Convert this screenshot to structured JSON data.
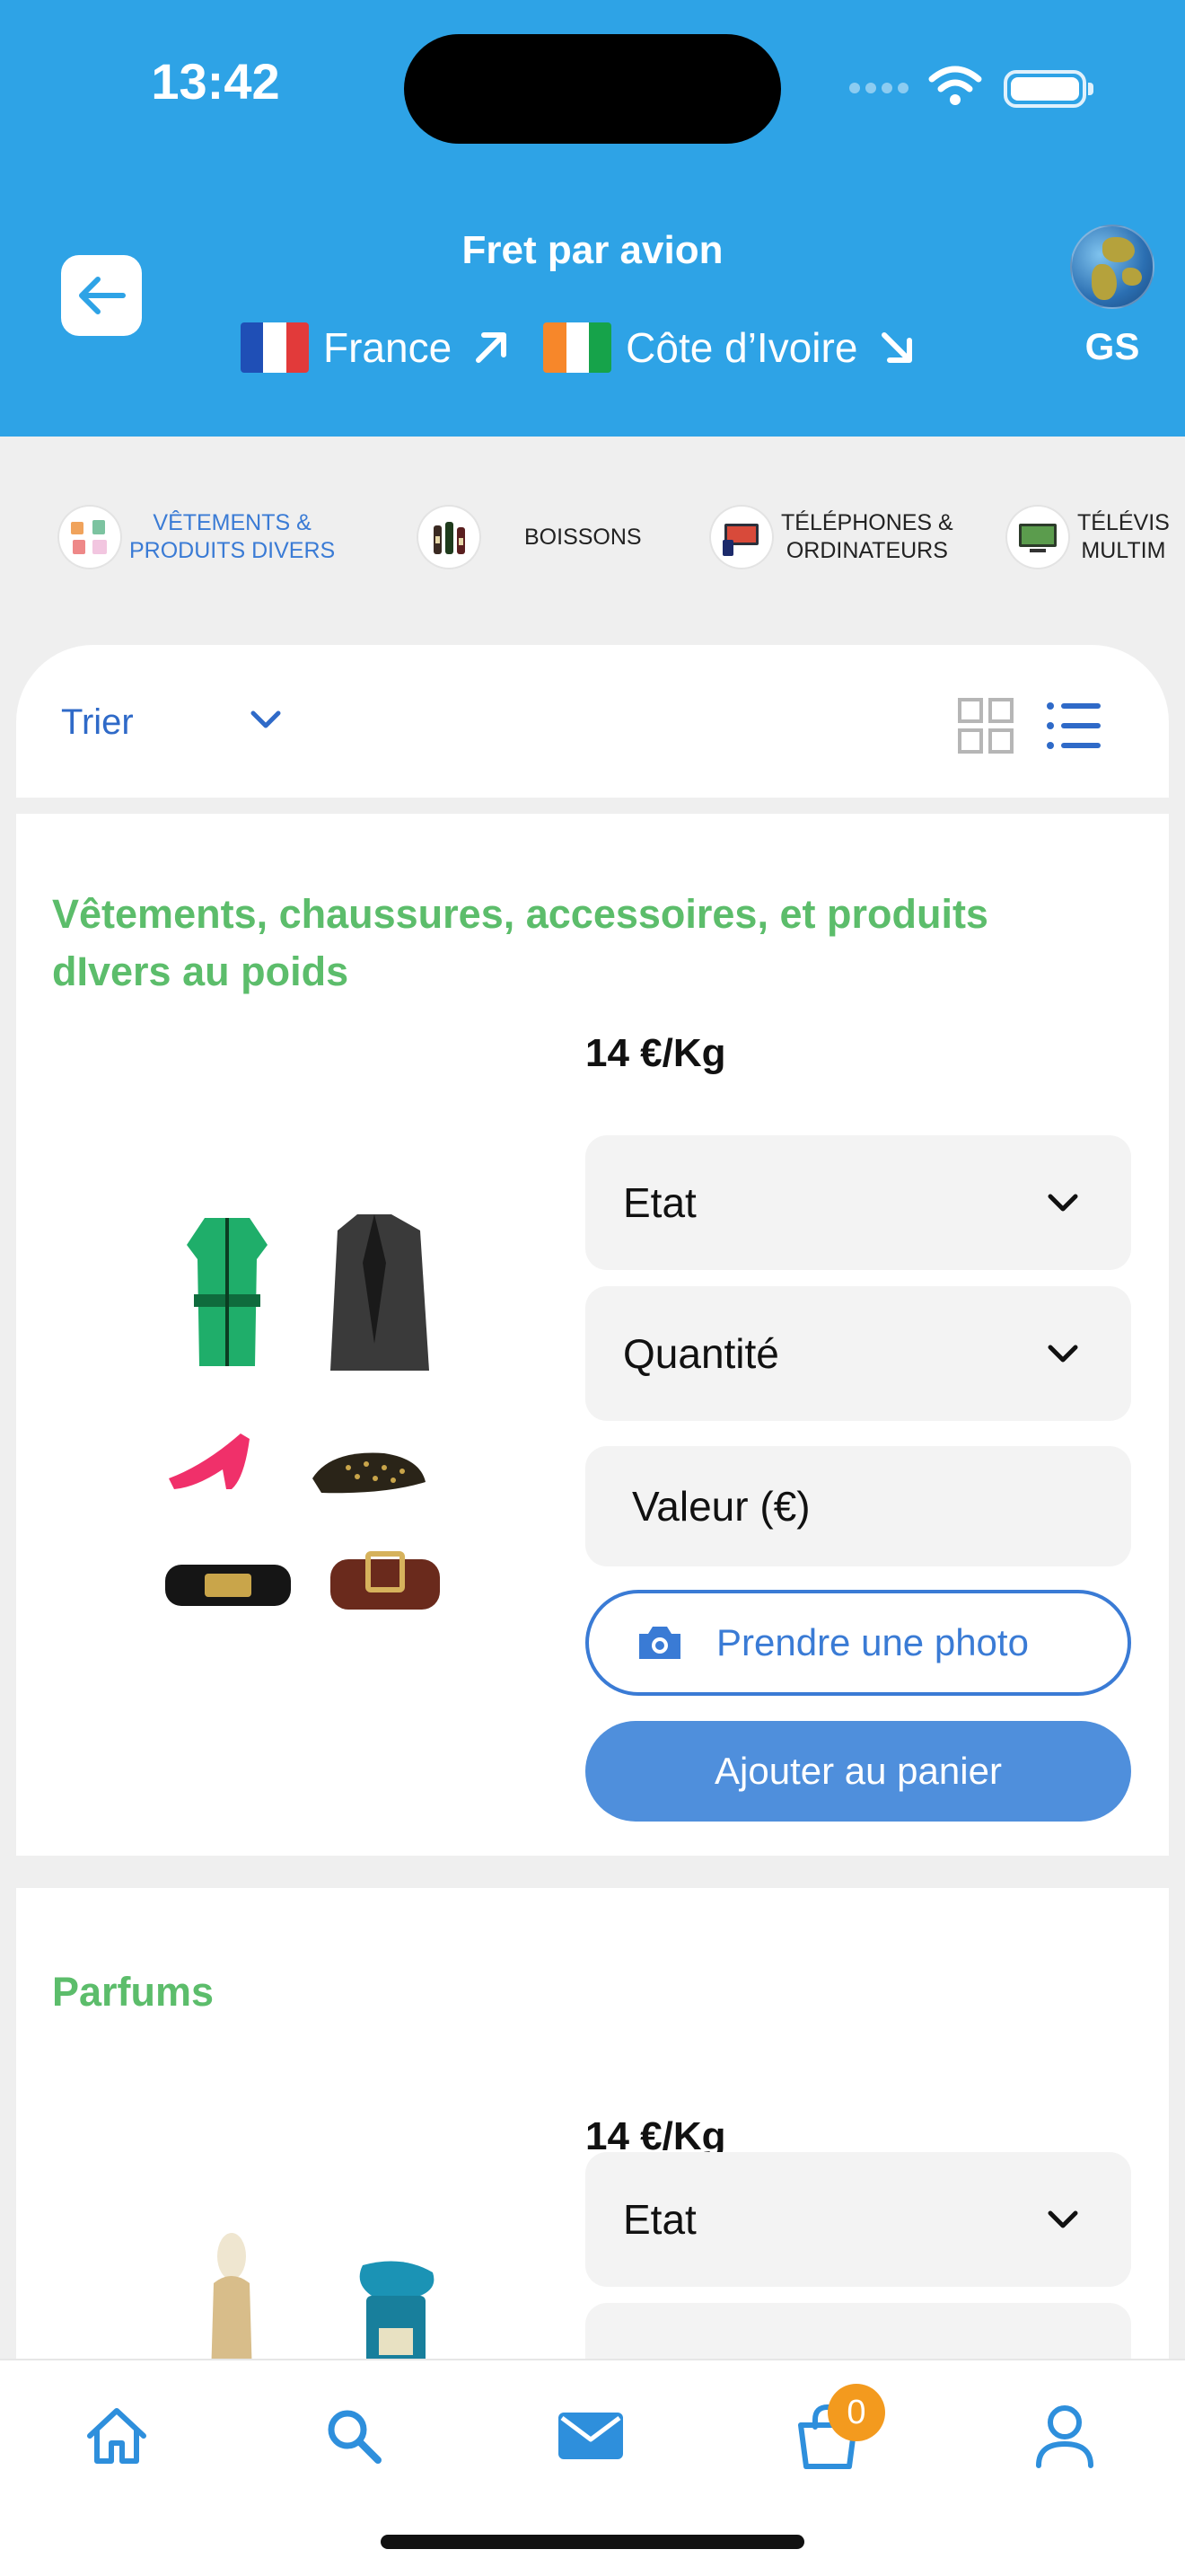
{
  "status_bar": {
    "time": "13:42"
  },
  "header": {
    "title": "Fret par avion",
    "origin": "France",
    "destination": "Côte d’Ivoire",
    "profile_code": "GS"
  },
  "categories": [
    {
      "label_line1": "VÊTEMENTS &",
      "label_line2": "PRODUITS DIVERS",
      "active": true
    },
    {
      "label_line1": "BOISSONS",
      "label_line2": "",
      "active": false
    },
    {
      "label_line1": "TÉLÉPHONES &",
      "label_line2": "ORDINATEURS",
      "active": false
    },
    {
      "label_line1": "TÉLÉVIS",
      "label_line2": "MULTIM",
      "active": false
    }
  ],
  "sort": {
    "label": "Trier"
  },
  "products": [
    {
      "title": "Vêtements, chaussures, accessoires, et produits dIvers au poids",
      "price": "14 €/Kg",
      "state_label": "Etat",
      "quantity_label": "Quantité",
      "value_placeholder": "Valeur (€)",
      "photo_label": "Prendre une photo",
      "cart_label": "Ajouter au panier"
    },
    {
      "title": "Parfums",
      "price": "14 €/Kg",
      "state_label": "Etat"
    }
  ],
  "bottom_nav": {
    "cart_count": "0"
  },
  "colors": {
    "header_bg": "#2ea3e6",
    "accent_blue": "#3a7bd5",
    "title_green": "#5cbd6b",
    "badge_orange": "#f39a1e"
  }
}
